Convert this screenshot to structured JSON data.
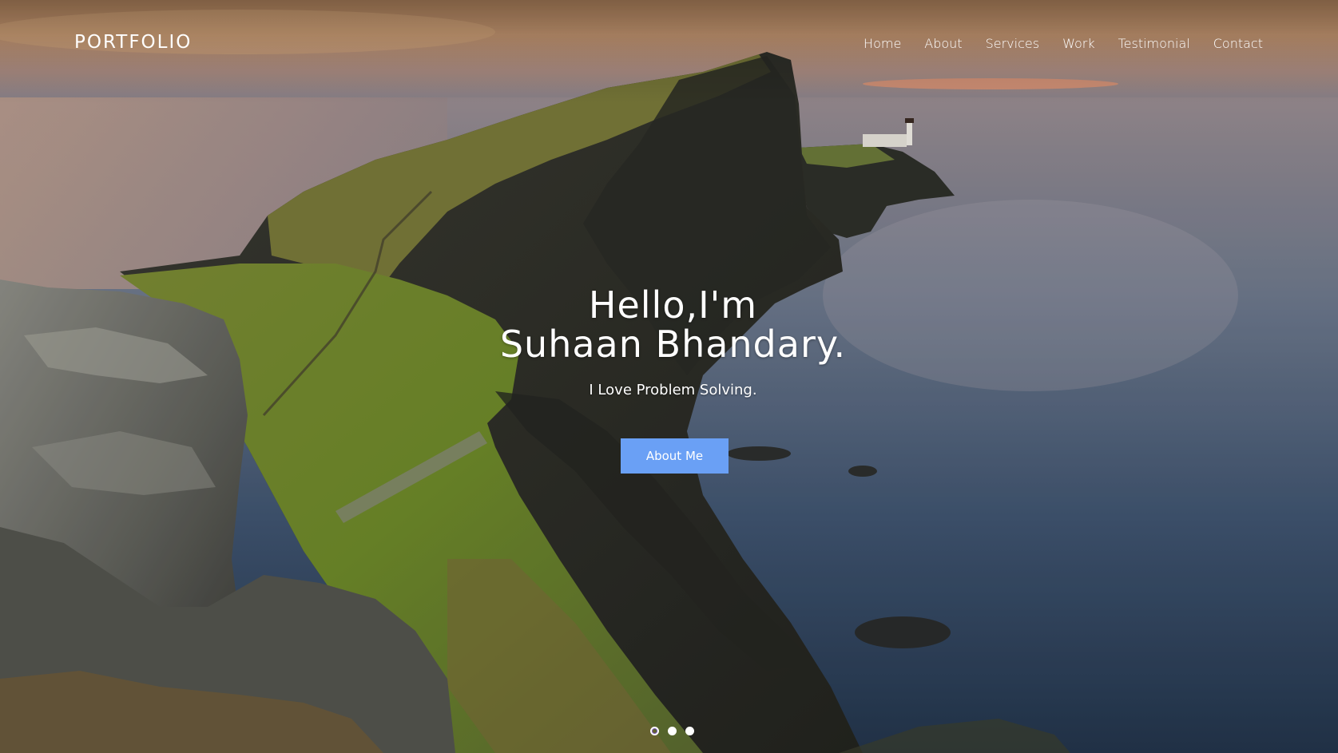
{
  "nav": {
    "brand": "PORTFOLIO",
    "items": [
      {
        "label": "Home"
      },
      {
        "label": "About"
      },
      {
        "label": "Services"
      },
      {
        "label": "Work"
      },
      {
        "label": "Testimonial"
      },
      {
        "label": "Contact"
      }
    ]
  },
  "hero": {
    "greeting_line1": "Hello,I'm",
    "greeting_line2": "Suhaan Bhandary.",
    "tagline": "I Love Problem Solving.",
    "cta_label": "About Me",
    "background": "coastal-cliff-lighthouse-sunset-photo",
    "slides": {
      "count": 3,
      "active": 1
    }
  },
  "colors": {
    "accent": "#6aa0f5",
    "text": "#ffffff",
    "active_dot_ring": "#7a55c7"
  }
}
